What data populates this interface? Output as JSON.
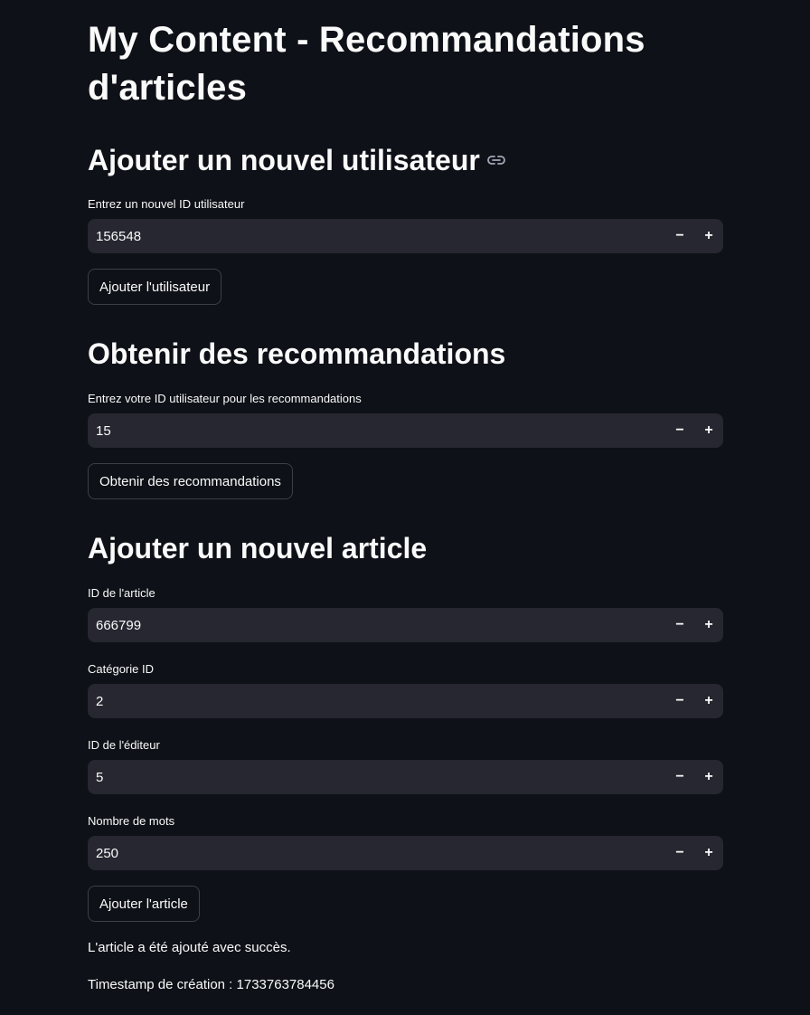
{
  "page": {
    "title": "My Content - Recommandations d'articles"
  },
  "add_user": {
    "heading": "Ajouter un nouvel utilisateur",
    "heading_icon": "link-icon",
    "input_label": "Entrez un nouvel ID utilisateur",
    "input_value": "156548",
    "button_label": "Ajouter l'utilisateur"
  },
  "recommendations": {
    "heading": "Obtenir des recommandations",
    "input_label": "Entrez votre ID utilisateur pour les recommandations",
    "input_value": "15",
    "button_label": "Obtenir des recommandations"
  },
  "add_article": {
    "heading": "Ajouter un nouvel article",
    "fields": [
      {
        "label": "ID de l'article",
        "value": "666799"
      },
      {
        "label": "Catégorie ID",
        "value": "2"
      },
      {
        "label": "ID de l'éditeur",
        "value": "5"
      },
      {
        "label": "Nombre de mots",
        "value": "250"
      }
    ],
    "button_label": "Ajouter l'article",
    "success_message": "L'article a été ajouté avec succès.",
    "timestamp_text": "Timestamp de création : 1733763784456"
  },
  "stepper": {
    "minus_symbol": "−",
    "plus_symbol": "+"
  },
  "colors": {
    "background": "#0e1117",
    "input_background": "#262730",
    "text": "#fafafa"
  }
}
